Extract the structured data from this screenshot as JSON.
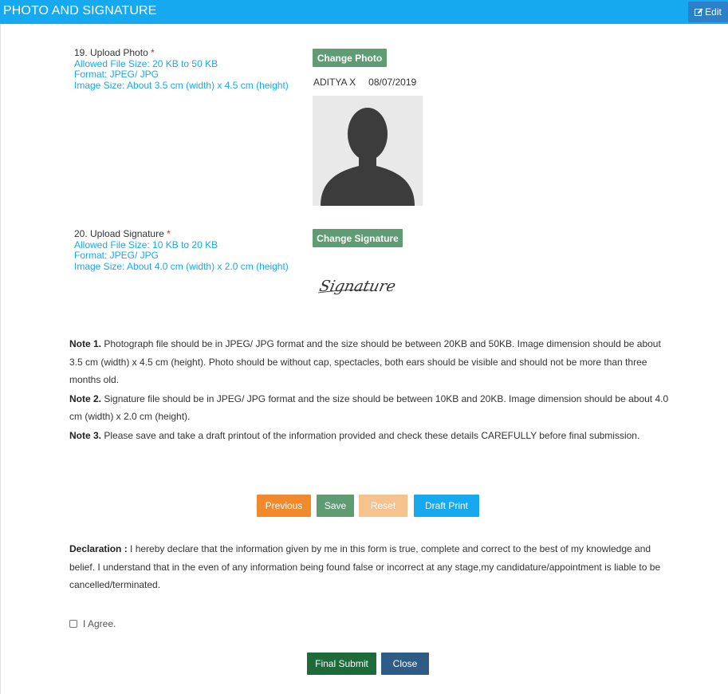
{
  "header": {
    "title": "PHOTO AND SIGNATURE",
    "edit_label": "Edit",
    "edit_icon": "edit-icon",
    "color": "#17a9f0"
  },
  "photo_field": {
    "label": "19. Upload Photo",
    "required_mark": "*",
    "hints": [
      "Allowed File Size: 20 KB to 50 KB",
      "Format: JPEG/ JPG",
      "Image Size: About 3.5 cm (width) x 4.5 cm (height)"
    ],
    "button_label": "Change Photo",
    "name": "ADITYA X",
    "date": "08/07/2019"
  },
  "signature_field": {
    "label": "20. Upload Signature",
    "required_mark": "*",
    "hints": [
      "Allowed File Size: 10 KB to 20 KB",
      "Format: JPEG/ JPG",
      "Image Size: About 4.0 cm (width) x 2.0 cm (height)"
    ],
    "button_label": "Change Signature",
    "signature_text": "Signature"
  },
  "notes": [
    {
      "title": "Note 1.",
      "text": "Photograph file should be in JPEG/ JPG format and the size should be between 20KB and 50KB. Image dimension should be about 3.5 cm (width) x 4.5 cm (height). Photo should be without cap, spectacles, both ears should be visible and should not be more than three months old."
    },
    {
      "title": "Note 2.",
      "text": "Signature file should be in JPEG/ JPG format and the size should be between 10KB and 20KB. Image dimension should be about 4.0 cm (width) x 2.0 cm (height)."
    },
    {
      "title": "Note 3.",
      "text": "Please save and take a draft printout of the information provided and check these details CAREFULLY before final submission."
    }
  ],
  "actions": {
    "previous": "Previous",
    "save": "Save",
    "reset": "Reset",
    "draft_print": "Draft Print"
  },
  "declaration": {
    "title": "Declaration :",
    "text": "I hereby declare that the information given by me in this form is true, complete and correct to the best of my knowledge and belief. I understand that in the even of any information being found false or incorrect at any stage,my candidature/appointment is liable to be cancelled/terminated."
  },
  "agree_label": "I Agree.",
  "final_actions": {
    "final_submit": "Final Submit",
    "close": "Close"
  }
}
